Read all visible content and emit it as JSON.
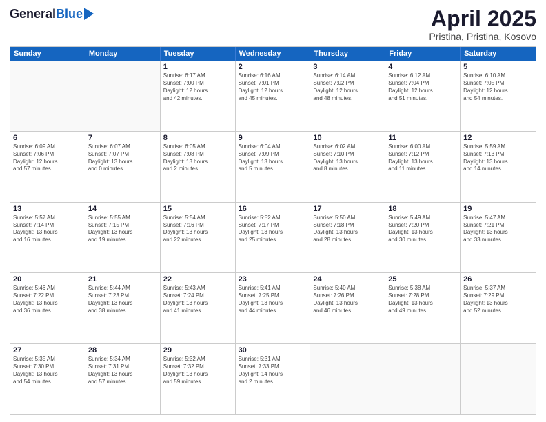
{
  "logo": {
    "general": "General",
    "blue": "Blue"
  },
  "header": {
    "title": "April 2025",
    "subtitle": "Pristina, Pristina, Kosovo"
  },
  "weekdays": [
    "Sunday",
    "Monday",
    "Tuesday",
    "Wednesday",
    "Thursday",
    "Friday",
    "Saturday"
  ],
  "weeks": [
    [
      {
        "day": "",
        "empty": true
      },
      {
        "day": "",
        "empty": true
      },
      {
        "day": "1",
        "line1": "Sunrise: 6:17 AM",
        "line2": "Sunset: 7:00 PM",
        "line3": "Daylight: 12 hours",
        "line4": "and 42 minutes."
      },
      {
        "day": "2",
        "line1": "Sunrise: 6:16 AM",
        "line2": "Sunset: 7:01 PM",
        "line3": "Daylight: 12 hours",
        "line4": "and 45 minutes."
      },
      {
        "day": "3",
        "line1": "Sunrise: 6:14 AM",
        "line2": "Sunset: 7:02 PM",
        "line3": "Daylight: 12 hours",
        "line4": "and 48 minutes."
      },
      {
        "day": "4",
        "line1": "Sunrise: 6:12 AM",
        "line2": "Sunset: 7:04 PM",
        "line3": "Daylight: 12 hours",
        "line4": "and 51 minutes."
      },
      {
        "day": "5",
        "line1": "Sunrise: 6:10 AM",
        "line2": "Sunset: 7:05 PM",
        "line3": "Daylight: 12 hours",
        "line4": "and 54 minutes."
      }
    ],
    [
      {
        "day": "6",
        "line1": "Sunrise: 6:09 AM",
        "line2": "Sunset: 7:06 PM",
        "line3": "Daylight: 12 hours",
        "line4": "and 57 minutes."
      },
      {
        "day": "7",
        "line1": "Sunrise: 6:07 AM",
        "line2": "Sunset: 7:07 PM",
        "line3": "Daylight: 13 hours",
        "line4": "and 0 minutes."
      },
      {
        "day": "8",
        "line1": "Sunrise: 6:05 AM",
        "line2": "Sunset: 7:08 PM",
        "line3": "Daylight: 13 hours",
        "line4": "and 2 minutes."
      },
      {
        "day": "9",
        "line1": "Sunrise: 6:04 AM",
        "line2": "Sunset: 7:09 PM",
        "line3": "Daylight: 13 hours",
        "line4": "and 5 minutes."
      },
      {
        "day": "10",
        "line1": "Sunrise: 6:02 AM",
        "line2": "Sunset: 7:10 PM",
        "line3": "Daylight: 13 hours",
        "line4": "and 8 minutes."
      },
      {
        "day": "11",
        "line1": "Sunrise: 6:00 AM",
        "line2": "Sunset: 7:12 PM",
        "line3": "Daylight: 13 hours",
        "line4": "and 11 minutes."
      },
      {
        "day": "12",
        "line1": "Sunrise: 5:59 AM",
        "line2": "Sunset: 7:13 PM",
        "line3": "Daylight: 13 hours",
        "line4": "and 14 minutes."
      }
    ],
    [
      {
        "day": "13",
        "line1": "Sunrise: 5:57 AM",
        "line2": "Sunset: 7:14 PM",
        "line3": "Daylight: 13 hours",
        "line4": "and 16 minutes."
      },
      {
        "day": "14",
        "line1": "Sunrise: 5:55 AM",
        "line2": "Sunset: 7:15 PM",
        "line3": "Daylight: 13 hours",
        "line4": "and 19 minutes."
      },
      {
        "day": "15",
        "line1": "Sunrise: 5:54 AM",
        "line2": "Sunset: 7:16 PM",
        "line3": "Daylight: 13 hours",
        "line4": "and 22 minutes."
      },
      {
        "day": "16",
        "line1": "Sunrise: 5:52 AM",
        "line2": "Sunset: 7:17 PM",
        "line3": "Daylight: 13 hours",
        "line4": "and 25 minutes."
      },
      {
        "day": "17",
        "line1": "Sunrise: 5:50 AM",
        "line2": "Sunset: 7:18 PM",
        "line3": "Daylight: 13 hours",
        "line4": "and 28 minutes."
      },
      {
        "day": "18",
        "line1": "Sunrise: 5:49 AM",
        "line2": "Sunset: 7:20 PM",
        "line3": "Daylight: 13 hours",
        "line4": "and 30 minutes."
      },
      {
        "day": "19",
        "line1": "Sunrise: 5:47 AM",
        "line2": "Sunset: 7:21 PM",
        "line3": "Daylight: 13 hours",
        "line4": "and 33 minutes."
      }
    ],
    [
      {
        "day": "20",
        "line1": "Sunrise: 5:46 AM",
        "line2": "Sunset: 7:22 PM",
        "line3": "Daylight: 13 hours",
        "line4": "and 36 minutes."
      },
      {
        "day": "21",
        "line1": "Sunrise: 5:44 AM",
        "line2": "Sunset: 7:23 PM",
        "line3": "Daylight: 13 hours",
        "line4": "and 38 minutes."
      },
      {
        "day": "22",
        "line1": "Sunrise: 5:43 AM",
        "line2": "Sunset: 7:24 PM",
        "line3": "Daylight: 13 hours",
        "line4": "and 41 minutes."
      },
      {
        "day": "23",
        "line1": "Sunrise: 5:41 AM",
        "line2": "Sunset: 7:25 PM",
        "line3": "Daylight: 13 hours",
        "line4": "and 44 minutes."
      },
      {
        "day": "24",
        "line1": "Sunrise: 5:40 AM",
        "line2": "Sunset: 7:26 PM",
        "line3": "Daylight: 13 hours",
        "line4": "and 46 minutes."
      },
      {
        "day": "25",
        "line1": "Sunrise: 5:38 AM",
        "line2": "Sunset: 7:28 PM",
        "line3": "Daylight: 13 hours",
        "line4": "and 49 minutes."
      },
      {
        "day": "26",
        "line1": "Sunrise: 5:37 AM",
        "line2": "Sunset: 7:29 PM",
        "line3": "Daylight: 13 hours",
        "line4": "and 52 minutes."
      }
    ],
    [
      {
        "day": "27",
        "line1": "Sunrise: 5:35 AM",
        "line2": "Sunset: 7:30 PM",
        "line3": "Daylight: 13 hours",
        "line4": "and 54 minutes."
      },
      {
        "day": "28",
        "line1": "Sunrise: 5:34 AM",
        "line2": "Sunset: 7:31 PM",
        "line3": "Daylight: 13 hours",
        "line4": "and 57 minutes."
      },
      {
        "day": "29",
        "line1": "Sunrise: 5:32 AM",
        "line2": "Sunset: 7:32 PM",
        "line3": "Daylight: 13 hours",
        "line4": "and 59 minutes."
      },
      {
        "day": "30",
        "line1": "Sunrise: 5:31 AM",
        "line2": "Sunset: 7:33 PM",
        "line3": "Daylight: 14 hours",
        "line4": "and 2 minutes."
      },
      {
        "day": "",
        "empty": true
      },
      {
        "day": "",
        "empty": true
      },
      {
        "day": "",
        "empty": true
      }
    ]
  ]
}
